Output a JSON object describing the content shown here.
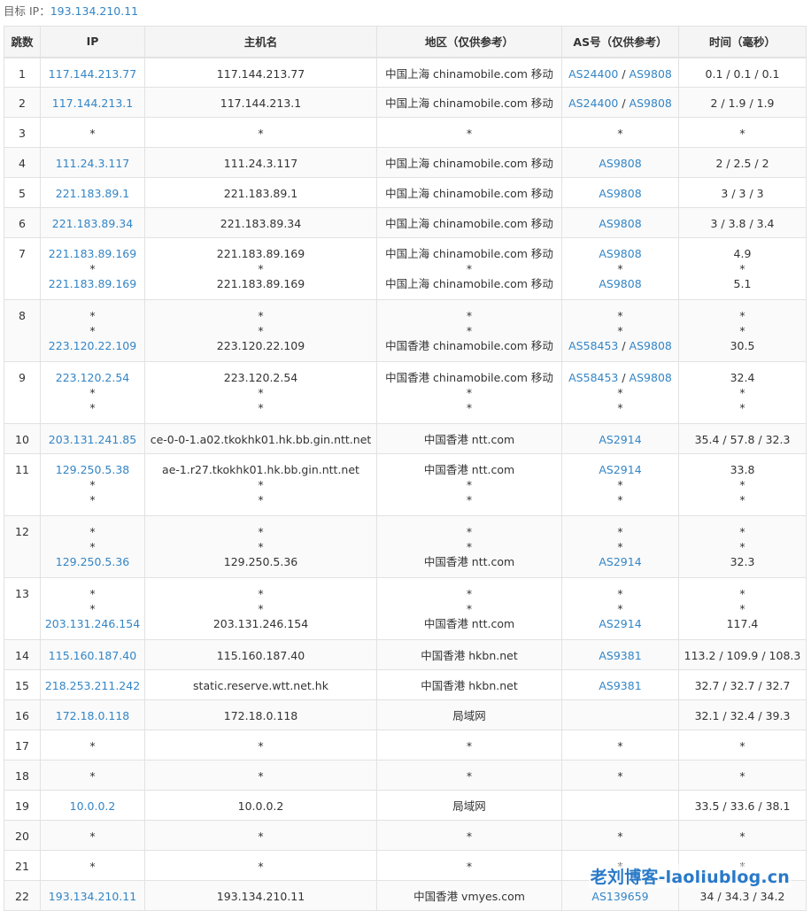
{
  "target": {
    "label": "目标 IP：",
    "ip": "193.134.210.11"
  },
  "headers": [
    "跳数",
    "IP",
    "主机名",
    "地区（仅供参考）",
    "AS号（仅供参考）",
    "时间（毫秒）"
  ],
  "rows": [
    {
      "hop": "1",
      "lines": [
        {
          "ip": "117.144.213.77",
          "host": "117.144.213.77",
          "region": "中国上海 chinamobile.com 移动",
          "as": [
            "AS24400",
            "AS9808"
          ],
          "time": "0.1 / 0.1 / 0.1"
        }
      ]
    },
    {
      "hop": "2",
      "lines": [
        {
          "ip": "117.144.213.1",
          "host": "117.144.213.1",
          "region": "中国上海 chinamobile.com 移动",
          "as": [
            "AS24400",
            "AS9808"
          ],
          "time": "2 / 1.9 / 1.9"
        }
      ]
    },
    {
      "hop": "3",
      "lines": [
        {
          "ip": "*",
          "host": "*",
          "region": "*",
          "as": [
            "*"
          ],
          "time": "*"
        }
      ]
    },
    {
      "hop": "4",
      "lines": [
        {
          "ip": "111.24.3.117",
          "host": "111.24.3.117",
          "region": "中国上海 chinamobile.com 移动",
          "as": [
            "AS9808"
          ],
          "time": "2 / 2.5 / 2"
        }
      ]
    },
    {
      "hop": "5",
      "lines": [
        {
          "ip": "221.183.89.1",
          "host": "221.183.89.1",
          "region": "中国上海 chinamobile.com 移动",
          "as": [
            "AS9808"
          ],
          "time": "3 / 3 / 3"
        }
      ]
    },
    {
      "hop": "6",
      "lines": [
        {
          "ip": "221.183.89.34",
          "host": "221.183.89.34",
          "region": "中国上海 chinamobile.com 移动",
          "as": [
            "AS9808"
          ],
          "time": "3 / 3.8 / 3.4"
        }
      ]
    },
    {
      "hop": "7",
      "lines": [
        {
          "ip": "221.183.89.169",
          "host": "221.183.89.169",
          "region": "中国上海 chinamobile.com 移动",
          "as": [
            "AS9808"
          ],
          "time": "4.9"
        },
        {
          "ip": "*",
          "host": "*",
          "region": "*",
          "as": [
            "*"
          ],
          "time": "*"
        },
        {
          "ip": "221.183.89.169",
          "host": "221.183.89.169",
          "region": "中国上海 chinamobile.com 移动",
          "as": [
            "AS9808"
          ],
          "time": "5.1"
        }
      ]
    },
    {
      "hop": "8",
      "lines": [
        {
          "ip": "*",
          "host": "*",
          "region": "*",
          "as": [
            "*"
          ],
          "time": "*"
        },
        {
          "ip": "*",
          "host": "*",
          "region": "*",
          "as": [
            "*"
          ],
          "time": "*"
        },
        {
          "ip": "223.120.22.109",
          "host": "223.120.22.109",
          "region": "中国香港 chinamobile.com 移动",
          "as": [
            "AS58453",
            "AS9808"
          ],
          "time": "30.5"
        }
      ]
    },
    {
      "hop": "9",
      "lines": [
        {
          "ip": "223.120.2.54",
          "host": "223.120.2.54",
          "region": "中国香港 chinamobile.com 移动",
          "as": [
            "AS58453",
            "AS9808"
          ],
          "time": "32.4"
        },
        {
          "ip": "*",
          "host": "*",
          "region": "*",
          "as": [
            "*"
          ],
          "time": "*"
        },
        {
          "ip": "*",
          "host": "*",
          "region": "*",
          "as": [
            "*"
          ],
          "time": "*"
        }
      ]
    },
    {
      "hop": "10",
      "lines": [
        {
          "ip": "203.131.241.85",
          "host": "ce-0-0-1.a02.tkokhk01.hk.bb.gin.ntt.net",
          "region": "中国香港 ntt.com",
          "as": [
            "AS2914"
          ],
          "time": "35.4 / 57.8 / 32.3"
        }
      ]
    },
    {
      "hop": "11",
      "lines": [
        {
          "ip": "129.250.5.38",
          "host": "ae-1.r27.tkokhk01.hk.bb.gin.ntt.net",
          "region": "中国香港 ntt.com",
          "as": [
            "AS2914"
          ],
          "time": "33.8"
        },
        {
          "ip": "*",
          "host": "*",
          "region": "*",
          "as": [
            "*"
          ],
          "time": "*"
        },
        {
          "ip": "*",
          "host": "*",
          "region": "*",
          "as": [
            "*"
          ],
          "time": "*"
        }
      ]
    },
    {
      "hop": "12",
      "lines": [
        {
          "ip": "*",
          "host": "*",
          "region": "*",
          "as": [
            "*"
          ],
          "time": "*"
        },
        {
          "ip": "*",
          "host": "*",
          "region": "*",
          "as": [
            "*"
          ],
          "time": "*"
        },
        {
          "ip": "129.250.5.36",
          "host": "129.250.5.36",
          "region": "中国香港 ntt.com",
          "as": [
            "AS2914"
          ],
          "time": "32.3"
        }
      ]
    },
    {
      "hop": "13",
      "lines": [
        {
          "ip": "*",
          "host": "*",
          "region": "*",
          "as": [
            "*"
          ],
          "time": "*"
        },
        {
          "ip": "*",
          "host": "*",
          "region": "*",
          "as": [
            "*"
          ],
          "time": "*"
        },
        {
          "ip": "203.131.246.154",
          "host": "203.131.246.154",
          "region": "中国香港 ntt.com",
          "as": [
            "AS2914"
          ],
          "time": "117.4"
        }
      ]
    },
    {
      "hop": "14",
      "lines": [
        {
          "ip": "115.160.187.40",
          "host": "115.160.187.40",
          "region": "中国香港 hkbn.net",
          "as": [
            "AS9381"
          ],
          "time": "113.2 / 109.9 / 108.3"
        }
      ]
    },
    {
      "hop": "15",
      "lines": [
        {
          "ip": "218.253.211.242",
          "host": "static.reserve.wtt.net.hk",
          "region": "中国香港 hkbn.net",
          "as": [
            "AS9381"
          ],
          "time": "32.7 / 32.7 / 32.7"
        }
      ]
    },
    {
      "hop": "16",
      "lines": [
        {
          "ip": "172.18.0.118",
          "host": "172.18.0.118",
          "region": "局域网",
          "as": [],
          "time": "32.1 / 32.4 / 39.3"
        }
      ]
    },
    {
      "hop": "17",
      "lines": [
        {
          "ip": "*",
          "host": "*",
          "region": "*",
          "as": [
            "*"
          ],
          "time": "*"
        }
      ]
    },
    {
      "hop": "18",
      "lines": [
        {
          "ip": "*",
          "host": "*",
          "region": "*",
          "as": [
            "*"
          ],
          "time": "*"
        }
      ]
    },
    {
      "hop": "19",
      "lines": [
        {
          "ip": "10.0.0.2",
          "host": "10.0.0.2",
          "region": "局域网",
          "as": [],
          "time": "33.5 / 33.6 / 38.1"
        }
      ]
    },
    {
      "hop": "20",
      "lines": [
        {
          "ip": "*",
          "host": "*",
          "region": "*",
          "as": [
            "*"
          ],
          "time": "*"
        }
      ]
    },
    {
      "hop": "21",
      "lines": [
        {
          "ip": "*",
          "host": "*",
          "region": "*",
          "as": [
            "*"
          ],
          "time": "*"
        }
      ]
    },
    {
      "hop": "22",
      "lines": [
        {
          "ip": "193.134.210.11",
          "host": "193.134.210.11",
          "region": "中国香港 vmyes.com",
          "as": [
            "AS139659"
          ],
          "time": "34 / 34.3 / 34.2"
        }
      ]
    }
  ],
  "watermark": "老刘博客-laoliublog.cn",
  "colors": {
    "link": "#3385c6",
    "header_bg": "#f5f5f5",
    "border": "#e2e2e2",
    "text": "#333333"
  }
}
